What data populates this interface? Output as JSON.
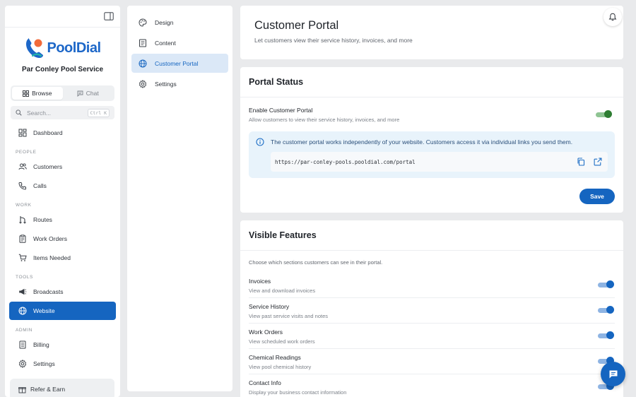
{
  "sidebar": {
    "logo_text": "PoolDial",
    "company_name": "Par Conley Pool Service",
    "mode_tabs": [
      {
        "label": "Browse",
        "icon": "grid-icon",
        "active": true
      },
      {
        "label": "Chat",
        "icon": "chat-icon",
        "active": false
      }
    ],
    "search": {
      "placeholder": "Search...",
      "shortcut": "Ctrl K"
    },
    "nav": {
      "dashboard": "Dashboard",
      "people_header": "PEOPLE",
      "customers": "Customers",
      "calls": "Calls",
      "work_header": "WORK",
      "routes": "Routes",
      "work_orders": "Work Orders",
      "items_needed": "Items Needed",
      "tools_header": "TOOLS",
      "broadcasts": "Broadcasts",
      "website": "Website",
      "admin_header": "ADMIN",
      "billing": "Billing",
      "settings": "Settings"
    },
    "active_item": "Website",
    "refer_label": "Refer & Earn"
  },
  "subnav": {
    "items": [
      {
        "label": "Design",
        "icon": "palette-icon"
      },
      {
        "label": "Content",
        "icon": "document-icon"
      },
      {
        "label": "Customer Portal",
        "icon": "globe-icon"
      },
      {
        "label": "Settings",
        "icon": "gear-icon"
      }
    ],
    "active_item": "Customer Portal"
  },
  "header": {
    "title": "Customer Portal",
    "subtitle": "Let customers view their service history, invoices, and more"
  },
  "portal_status": {
    "title": "Portal Status",
    "enable_label": "Enable Customer Portal",
    "enable_desc": "Allow customers to view their service history, invoices, and more",
    "enabled": true,
    "info_text": "The customer portal works independently of your website. Customers access it via individual links you send them.",
    "portal_url": "https://par-conley-pools.pooldial.com/portal",
    "save_label": "Save"
  },
  "visible_features": {
    "title": "Visible Features",
    "intro": "Choose which sections customers can see in their portal.",
    "items": [
      {
        "label": "Invoices",
        "desc": "View and download invoices",
        "enabled": true
      },
      {
        "label": "Service History",
        "desc": "View past service visits and notes",
        "enabled": true
      },
      {
        "label": "Work Orders",
        "desc": "View scheduled work orders",
        "enabled": true
      },
      {
        "label": "Chemical Readings",
        "desc": "View pool chemical history",
        "enabled": true
      },
      {
        "label": "Contact Info",
        "desc": "Display your business contact information",
        "enabled": true
      }
    ]
  },
  "colors": {
    "primary": "#1565c0",
    "success": "#2e7d32",
    "info_bg": "#e8f3fb",
    "page_bg": "#e9eaec"
  }
}
